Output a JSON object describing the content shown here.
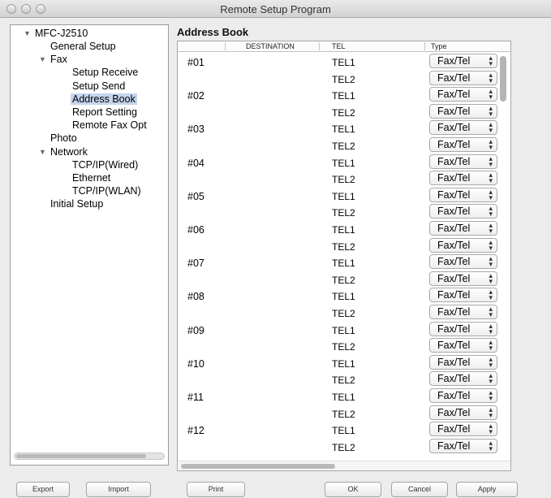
{
  "window": {
    "title": "Remote Setup Program"
  },
  "tree": {
    "root": "MFC-J2510",
    "items": [
      {
        "label": "General Setup",
        "level": 1,
        "expandable": false
      },
      {
        "label": "Fax",
        "level": 1,
        "expandable": true
      },
      {
        "label": "Setup Receive",
        "level": 2,
        "expandable": false
      },
      {
        "label": "Setup Send",
        "level": 2,
        "expandable": false
      },
      {
        "label": "Address Book",
        "level": 2,
        "expandable": false,
        "selected": true
      },
      {
        "label": "Report Setting",
        "level": 2,
        "expandable": false
      },
      {
        "label": "Remote Fax Opt",
        "level": 2,
        "expandable": false
      },
      {
        "label": "Photo",
        "level": 1,
        "expandable": false
      },
      {
        "label": "Network",
        "level": 1,
        "expandable": true
      },
      {
        "label": "TCP/IP(Wired)",
        "level": 2,
        "expandable": false
      },
      {
        "label": "Ethernet",
        "level": 2,
        "expandable": false
      },
      {
        "label": "TCP/IP(WLAN)",
        "level": 2,
        "expandable": false
      },
      {
        "label": "Initial Setup",
        "level": 1,
        "expandable": false
      }
    ]
  },
  "address_book": {
    "title": "Address Book",
    "columns": {
      "destination": "DESTINATION",
      "tel": "TEL",
      "type": "Type"
    },
    "entries": [
      {
        "num": "#01",
        "tel1": "TEL1",
        "tel2": "TEL2",
        "type1": "Fax/Tel",
        "type2": "Fax/Tel"
      },
      {
        "num": "#02",
        "tel1": "TEL1",
        "tel2": "TEL2",
        "type1": "Fax/Tel",
        "type2": "Fax/Tel"
      },
      {
        "num": "#03",
        "tel1": "TEL1",
        "tel2": "TEL2",
        "type1": "Fax/Tel",
        "type2": "Fax/Tel"
      },
      {
        "num": "#04",
        "tel1": "TEL1",
        "tel2": "TEL2",
        "type1": "Fax/Tel",
        "type2": "Fax/Tel"
      },
      {
        "num": "#05",
        "tel1": "TEL1",
        "tel2": "TEL2",
        "type1": "Fax/Tel",
        "type2": "Fax/Tel"
      },
      {
        "num": "#06",
        "tel1": "TEL1",
        "tel2": "TEL2",
        "type1": "Fax/Tel",
        "type2": "Fax/Tel"
      },
      {
        "num": "#07",
        "tel1": "TEL1",
        "tel2": "TEL2",
        "type1": "Fax/Tel",
        "type2": "Fax/Tel"
      },
      {
        "num": "#08",
        "tel1": "TEL1",
        "tel2": "TEL2",
        "type1": "Fax/Tel",
        "type2": "Fax/Tel"
      },
      {
        "num": "#09",
        "tel1": "TEL1",
        "tel2": "TEL2",
        "type1": "Fax/Tel",
        "type2": "Fax/Tel"
      },
      {
        "num": "#10",
        "tel1": "TEL1",
        "tel2": "TEL2",
        "type1": "Fax/Tel",
        "type2": "Fax/Tel"
      },
      {
        "num": "#11",
        "tel1": "TEL1",
        "tel2": "TEL2",
        "type1": "Fax/Tel",
        "type2": "Fax/Tel"
      },
      {
        "num": "#12",
        "tel1": "TEL1",
        "tel2": "TEL2",
        "type1": "Fax/Tel",
        "type2": "Fax/Tel"
      }
    ]
  },
  "buttons": {
    "export": "Export",
    "import": "Import",
    "print": "Print",
    "ok": "OK",
    "cancel": "Cancel",
    "apply": "Apply"
  },
  "icons": {
    "expand": "disclosure-triangle-icon",
    "select": "up-down-arrows-icon"
  },
  "colors": {
    "selection": "#c5d5ee",
    "window_bg": "#ececec"
  }
}
